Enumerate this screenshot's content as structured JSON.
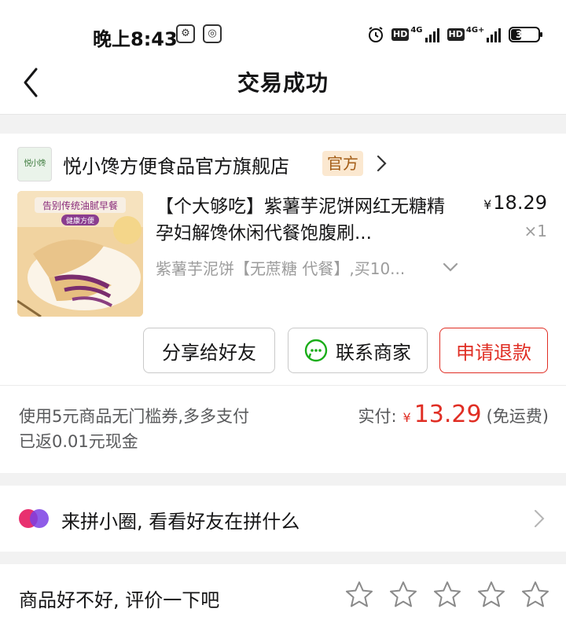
{
  "status_bar": {
    "time": "晚上8:43",
    "battery": "37",
    "network_1": "4G",
    "network_2": "4G+"
  },
  "header": {
    "title": "交易成功",
    "back_icon": "chevron-left-icon"
  },
  "store": {
    "logo_text": "悦小馋",
    "name": "悦小馋方便食品官方旗舰店",
    "badge": "官方"
  },
  "product": {
    "title": "【个大够吃】紫薯芋泥饼网红无糖精孕妇解馋休闲代餐饱腹刷...",
    "price": "18.29",
    "currency": "¥",
    "quantity": "×1",
    "spec": "紫薯芋泥饼【无蔗糖 代餐】,买10...",
    "image_caption": "告别传统油腻早餐",
    "image_sub": "健康方便"
  },
  "actions": {
    "share": "分享给好友",
    "contact": "联系商家",
    "refund": "申请退款"
  },
  "payment": {
    "coupon_note": "使用5元商品无门槛券,多多支付已返0.01元现金",
    "paid_label": "实付:",
    "currency": "¥",
    "amount": "13.29",
    "shipping": "(免运费)"
  },
  "group_circle": {
    "text": "来拼小圈, 看看好友在拼什么"
  },
  "rating": {
    "prompt": "商品好不好, 评价一下吧",
    "stars_total": 5,
    "stars_selected": 0
  },
  "colors": {
    "accent_red": "#e02e24",
    "badge_bg": "#fbe8d0",
    "badge_text": "#a35d16"
  }
}
